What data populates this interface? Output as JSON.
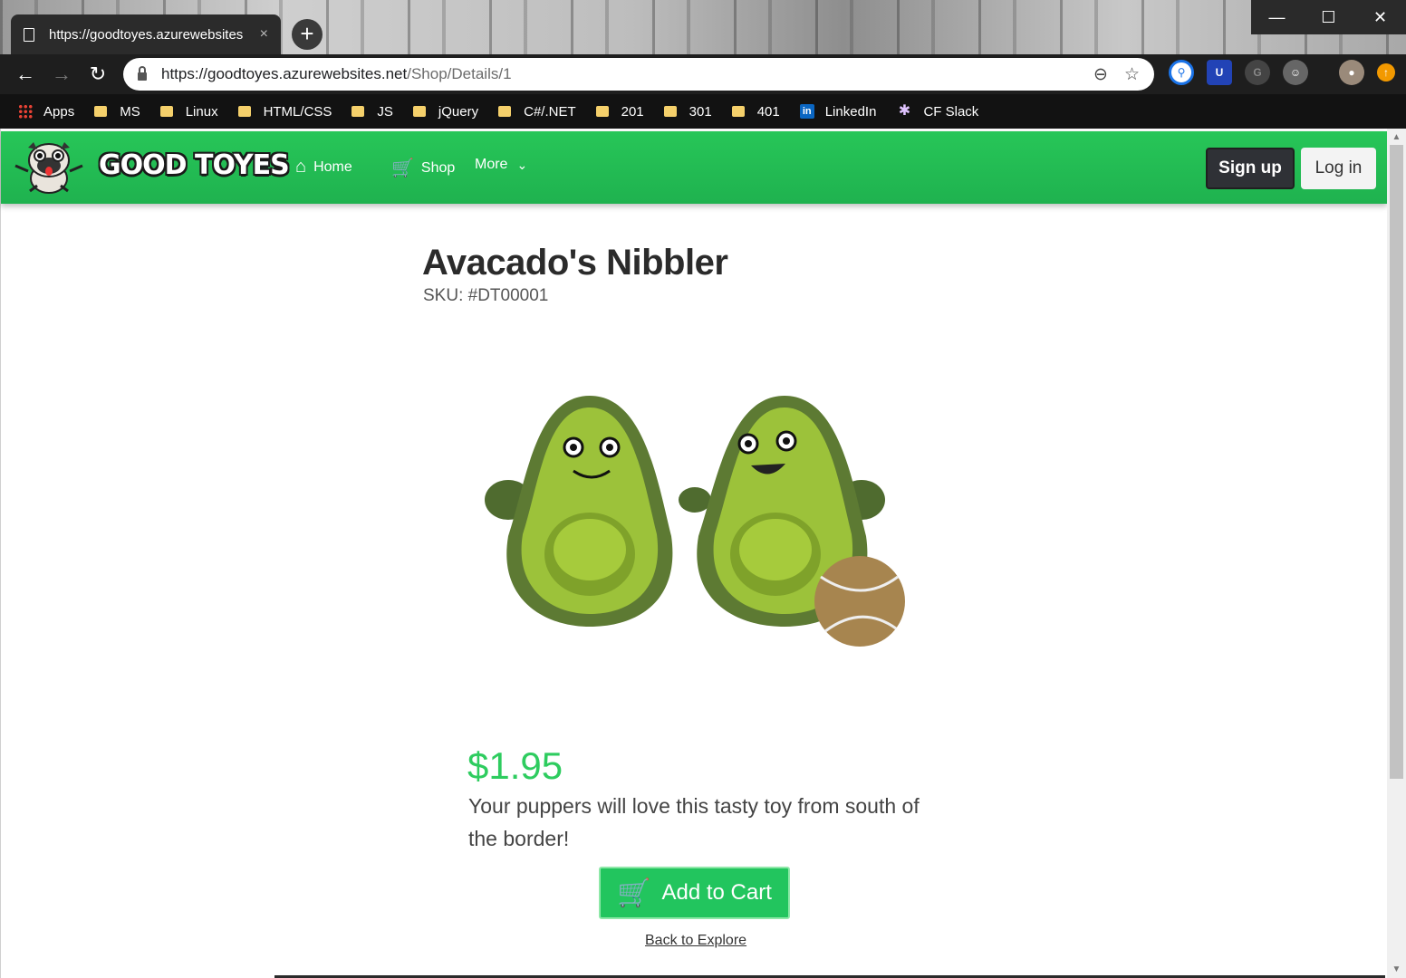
{
  "browser": {
    "tab_title": "https://goodtoyes.azurewebsites",
    "tab_close": "×",
    "new_tab": "+",
    "url_host": "https://goodtoyes.azurewebsites.net",
    "url_path": "/Shop/Details/1",
    "window_controls": {
      "minimize": "—",
      "maximize": "☐",
      "close": "✕"
    },
    "nav": {
      "back": "←",
      "forward": "→",
      "reload": "↻"
    },
    "bookmarks": [
      {
        "label": "Apps",
        "icon": "apps-grid-icon"
      },
      {
        "label": "MS",
        "icon": "folder-icon"
      },
      {
        "label": "Linux",
        "icon": "folder-icon"
      },
      {
        "label": "HTML/CSS",
        "icon": "folder-icon"
      },
      {
        "label": "JS",
        "icon": "folder-icon"
      },
      {
        "label": "jQuery",
        "icon": "folder-icon"
      },
      {
        "label": "C#/.NET",
        "icon": "folder-icon"
      },
      {
        "label": "201",
        "icon": "folder-icon"
      },
      {
        "label": "301",
        "icon": "folder-icon"
      },
      {
        "label": "401",
        "icon": "folder-icon"
      },
      {
        "label": "LinkedIn",
        "icon": "linkedin-icon"
      },
      {
        "label": "CF Slack",
        "icon": "slack-icon"
      }
    ]
  },
  "site": {
    "brand": "GOOD TOYES",
    "nav": {
      "home": "Home",
      "shop": "Shop",
      "more": "More"
    },
    "signup": "Sign up",
    "login": "Log in",
    "accent_color": "#22c55e"
  },
  "product": {
    "title": "Avacado's Nibbler",
    "sku": "SKU: #DT00001",
    "price": "$1.95",
    "description": "Your puppers will love this tasty toy from south of the border!",
    "add_to_cart": "Add to Cart",
    "back_link": "Back to Explore"
  }
}
